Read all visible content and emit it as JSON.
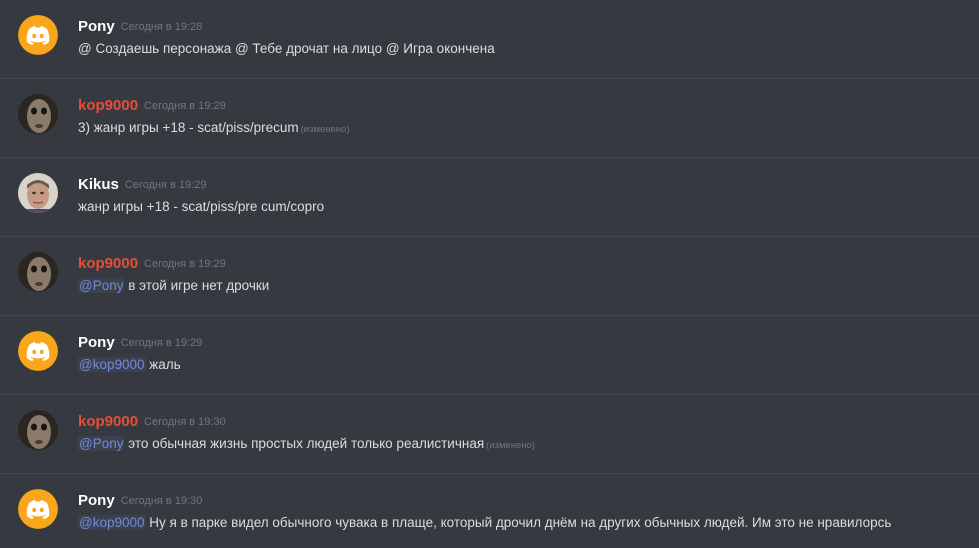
{
  "colors": {
    "background": "#36393f",
    "pony_name": "#ffffff",
    "kop_name": "#e74c3c",
    "kikus_name": "#ffffff",
    "mention": "#7289da",
    "discord_orange": "#faa61a"
  },
  "messages": [
    {
      "author": "Pony",
      "avatar_icon": "discord-logo-icon",
      "timestamp": "Сегодня в 19:28",
      "content": "@ Создаешь персонажа @ Тебе дрочат на лицо @ Игра окончена"
    },
    {
      "author": "kop9000",
      "avatar_icon": "face-photo-avatar",
      "timestamp": "Сегодня в 19:29",
      "content": "3) жанр игры +18 - scat/piss/precum",
      "edited": "(изменено)"
    },
    {
      "author": "Kikus",
      "avatar_icon": "man-photo-avatar",
      "timestamp": "Сегодня в 19:29",
      "content": "жанр игры +18 - scat/piss/pre cum/copro"
    },
    {
      "author": "kop9000",
      "avatar_icon": "face-photo-avatar",
      "timestamp": "Сегодня в 19:29",
      "mention": "@Pony",
      "content": " в этой игре нет дрочки"
    },
    {
      "author": "Pony",
      "avatar_icon": "discord-logo-icon",
      "timestamp": "Сегодня в 19:29",
      "mention": "@kop9000",
      "content": " жаль"
    },
    {
      "author": "kop9000",
      "avatar_icon": "face-photo-avatar",
      "timestamp": "Сегодня в 19:30",
      "mention": "@Pony",
      "content": " это обычная жизнь простых людей только реалистичная",
      "edited": "(изменено)"
    },
    {
      "author": "Pony",
      "avatar_icon": "discord-logo-icon",
      "timestamp": "Сегодня в 19:30",
      "mention": "@kop9000",
      "content": " Ну я в парке видел обычного чувака в плаще, который дрочил днём на других обычных людей. Им это не нравилорсь"
    }
  ]
}
